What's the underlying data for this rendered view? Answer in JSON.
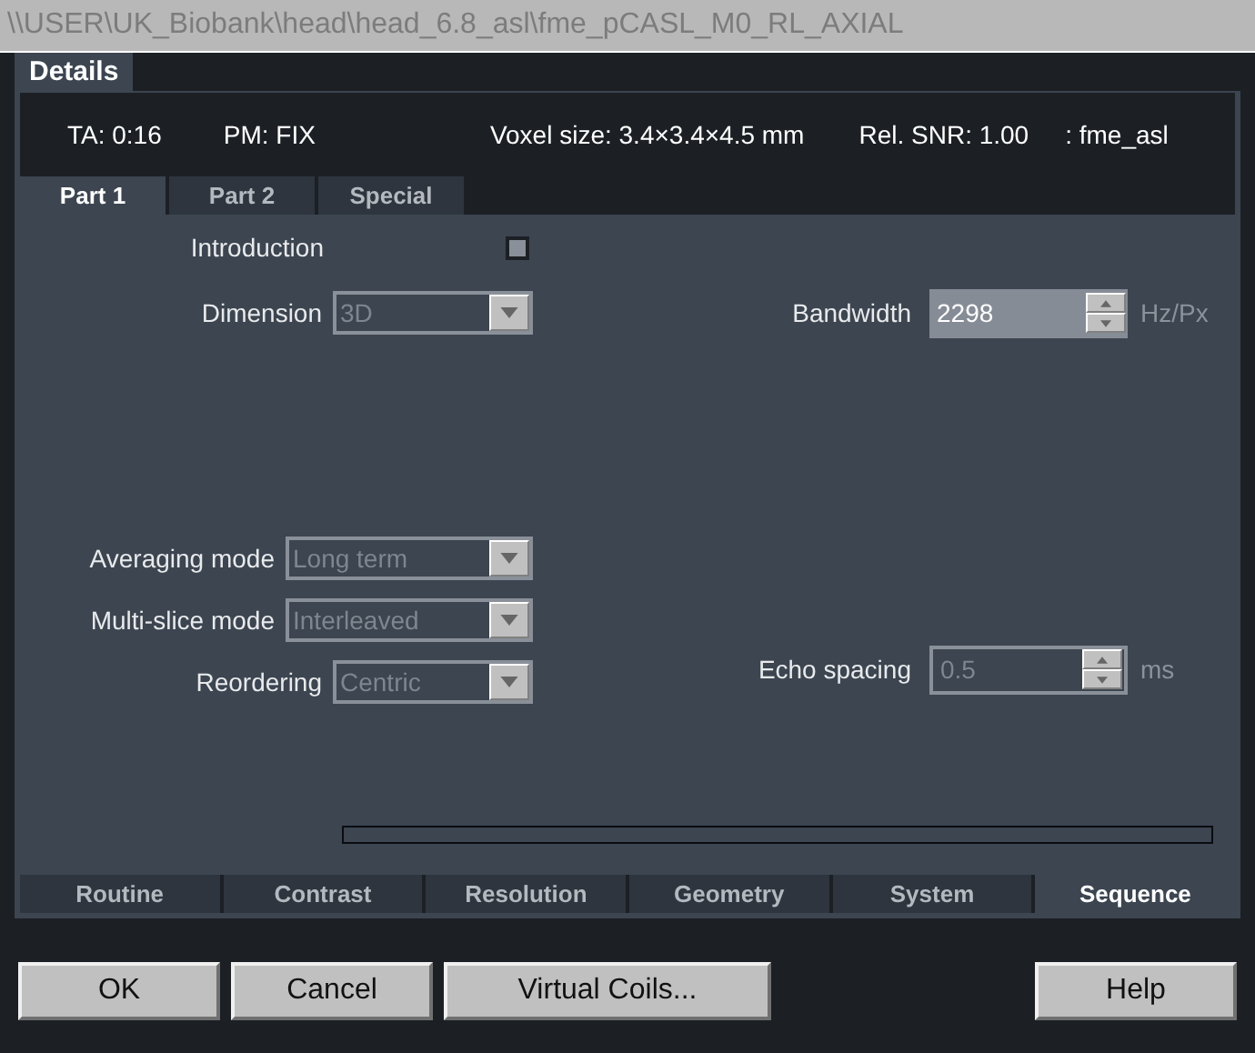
{
  "window": {
    "title": "\\\\USER\\UK_Biobank\\head\\head_6.8_asl\\fme_pCASL_M0_RL_AXIAL"
  },
  "top_tabs": [
    {
      "label": "Details",
      "selected": true
    }
  ],
  "info": [
    "TA: 0:16",
    "PM: FIX",
    "Voxel size: 3.4×3.4×4.5 mm",
    "Rel. SNR: 1.00",
    ": fme_asl"
  ],
  "sub_tabs": [
    {
      "label": "Part 1",
      "selected": true
    },
    {
      "label": "Part 2",
      "selected": false
    },
    {
      "label": "Special",
      "selected": false
    }
  ],
  "left_top": [
    {
      "kind": "checkbox",
      "label": "Introduction",
      "checked": false
    },
    {
      "kind": "dropdown",
      "label": "Dimension",
      "value": "3D",
      "disabled": true
    }
  ],
  "left_bottom": [
    {
      "kind": "dropdown",
      "label": "Averaging mode",
      "value": "Long term",
      "disabled": true
    },
    {
      "kind": "dropdown",
      "label": "Multi-slice mode",
      "value": "Interleaved",
      "disabled": true
    },
    {
      "kind": "dropdown",
      "label": "Reordering",
      "value": "Centric",
      "disabled": true
    }
  ],
  "right_top": [
    {
      "kind": "spinner",
      "label": "Bandwidth",
      "value": "2298",
      "unit": "Hz/Px",
      "disabled": false
    }
  ],
  "right_bottom": [
    {
      "kind": "spinner",
      "label": "Echo spacing",
      "value": "0.5",
      "unit": "ms",
      "disabled": true
    }
  ],
  "bottom_tabs": [
    {
      "label": "Routine",
      "selected": false
    },
    {
      "label": "Contrast",
      "selected": false
    },
    {
      "label": "Resolution",
      "selected": false
    },
    {
      "label": "Geometry",
      "selected": false
    },
    {
      "label": "System",
      "selected": false
    },
    {
      "label": "Sequence",
      "selected": true
    }
  ],
  "buttons_left": [
    "OK",
    "Cancel",
    "Virtual Coils..."
  ],
  "buttons_right": [
    "Help"
  ]
}
